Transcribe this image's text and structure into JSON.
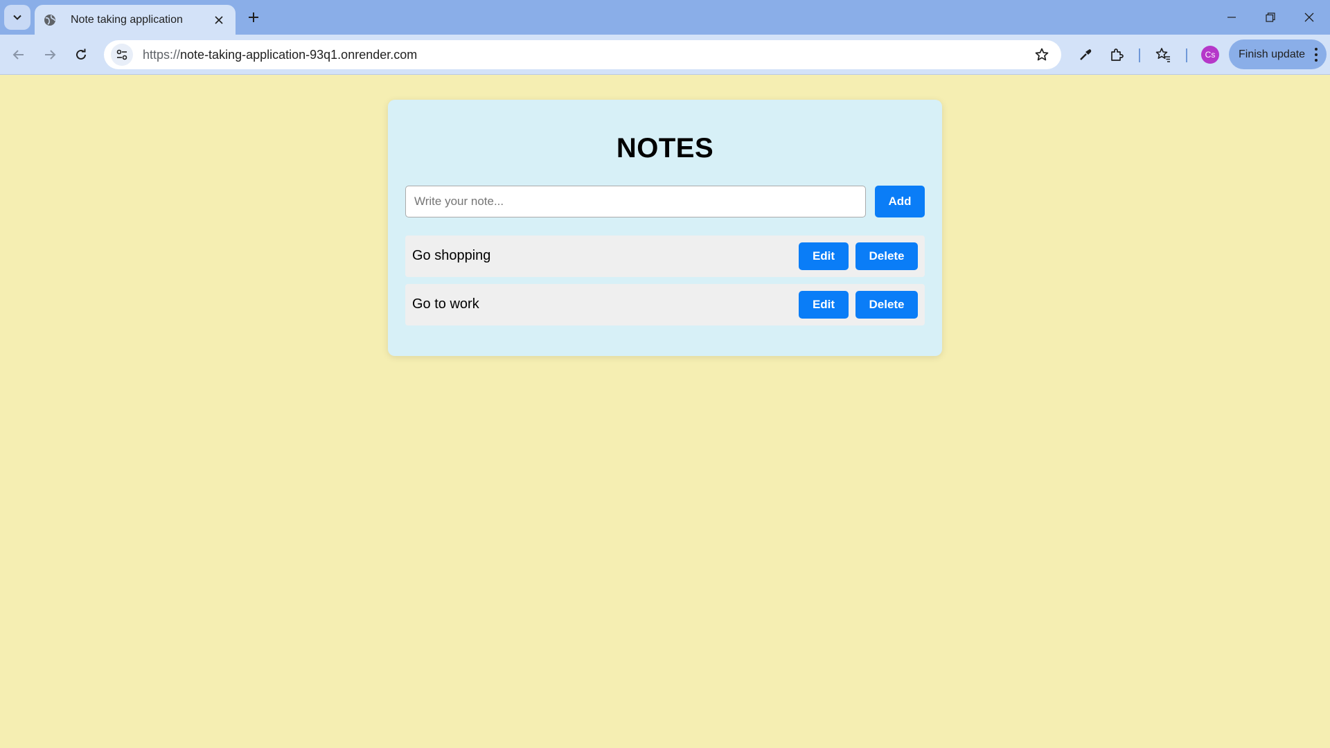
{
  "browser": {
    "tab": {
      "title": "Note taking application"
    },
    "address_bar": {
      "url_scheme": "https://",
      "url_host": "note-taking-application-93q1.onrender.com"
    },
    "profile_initials": "Cs",
    "finish_update_label": "Finish update"
  },
  "app": {
    "heading": "NOTES",
    "note_input": {
      "placeholder": "Write your note...",
      "value": ""
    },
    "add_label": "Add",
    "notes": [
      {
        "text": "Go shopping",
        "edit_label": "Edit",
        "delete_label": "Delete"
      },
      {
        "text": "Go to work",
        "edit_label": "Edit",
        "delete_label": "Delete"
      }
    ]
  },
  "colors": {
    "page_background": "#f5eeb2",
    "card_background": "#d7f0f7",
    "button_primary": "#0a7df7",
    "note_row_background": "#efefef",
    "browser_tabbar": "#8aaee8",
    "avatar": "#b538c9"
  },
  "icons": {
    "tab_search": "chevron-down-icon",
    "favicon": "globe-icon",
    "tab_close": "close-icon",
    "new_tab": "plus-icon",
    "back": "arrow-left-icon",
    "forward": "arrow-right-icon",
    "reload": "reload-icon",
    "site_info": "tune-icon",
    "bookmark": "star-outline-icon",
    "eyedropper": "eyedropper-icon",
    "extensions": "puzzle-icon",
    "bookmarks_list": "star-list-icon",
    "menu": "more-vertical-icon"
  }
}
